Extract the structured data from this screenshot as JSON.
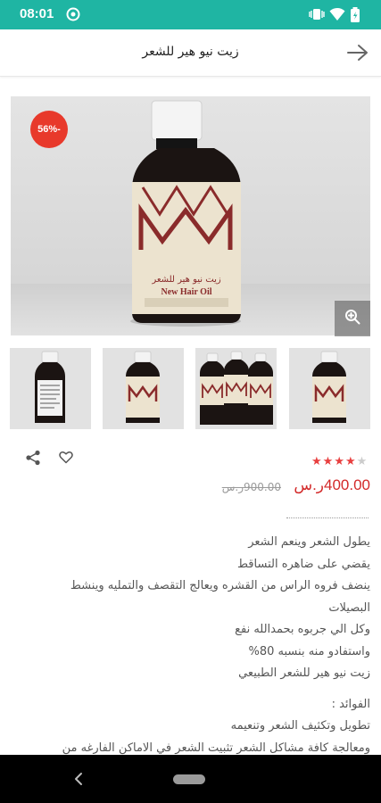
{
  "status_bar": {
    "time": "08:01",
    "icons": [
      "at-sign-icon",
      "vibrate-icon",
      "wifi-icon",
      "battery-icon"
    ]
  },
  "header": {
    "title": "زيت نيو هير للشعر",
    "back_icon": "arrow-right-icon"
  },
  "product": {
    "discount_badge": "56%-",
    "label_brand": "زيت نيو هير للشعر",
    "label_brand_en": "New Hair Oil",
    "thumbnails": [
      "thumb-bottle-back",
      "thumb-bottle-front",
      "thumb-three-bottles",
      "thumb-bottle-front-2"
    ],
    "rating": 3.5,
    "rating_max": 5,
    "price": "400.00ر.س",
    "old_price": "900.00ر.س"
  },
  "description": {
    "lines": [
      "يطول الشعر وينعم الشعر",
      "يقضي على ضاهره التساقط",
      "ينضف فروه الراس من القشره ويعالج التقصف والتمليه وينشط",
      "البصيلات",
      "وكل الي جربوه بحمدالله نفع",
      "واستفادو منه بنسبه 80%",
      "زيت نيو هير للشعر الطبيعي"
    ],
    "benefits_title": "الفوائد :",
    "benefits": [
      "تطويل وتكثيف الشعر وتنعيمه",
      "ومعالجة كافة مشاكل الشعر تثبيت الشعر في الاماكن الفارغه من"
    ]
  },
  "colors": {
    "status_bar": "#1fb5a3",
    "price": "#d32a2a",
    "badge": "#e8392b",
    "star_on": "#e83f3f"
  }
}
